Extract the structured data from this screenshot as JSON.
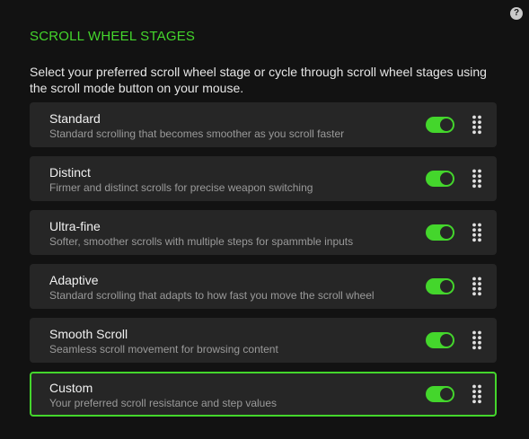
{
  "help": {
    "glyph": "?"
  },
  "page": {
    "title": "SCROLL WHEEL STAGES",
    "description": "Select your preferred scroll wheel stage or cycle through scroll wheel stages using the scroll mode button on your mouse."
  },
  "colors": {
    "accent": "#44d62c",
    "background": "#121212",
    "card": "#262626"
  },
  "stages": [
    {
      "name": "Standard",
      "description": "Standard scrolling that becomes smoother as you scroll faster",
      "enabled": true,
      "selected": false
    },
    {
      "name": "Distinct",
      "description": "Firmer and distinct scrolls for precise weapon switching",
      "enabled": true,
      "selected": false
    },
    {
      "name": "Ultra-fine",
      "description": "Softer, smoother scrolls with multiple steps for spammble inputs",
      "enabled": true,
      "selected": false
    },
    {
      "name": "Adaptive",
      "description": "Standard scrolling that adapts to how fast you move the scroll wheel",
      "enabled": true,
      "selected": false
    },
    {
      "name": "Smooth Scroll",
      "description": "Seamless scroll movement for browsing content",
      "enabled": true,
      "selected": false
    },
    {
      "name": "Custom",
      "description": "Your preferred scroll resistance and step values",
      "enabled": true,
      "selected": true
    }
  ]
}
